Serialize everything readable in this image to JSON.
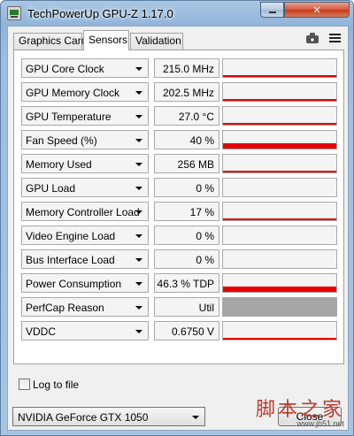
{
  "window": {
    "title": "TechPowerUp GPU-Z 1.17.0"
  },
  "tabs": [
    {
      "label": "Graphics Card"
    },
    {
      "label": "Sensors"
    },
    {
      "label": "Validation"
    }
  ],
  "icons": {
    "camera": "camera-icon",
    "menu": "menu-icon"
  },
  "accent_color": "#e60000",
  "sensors": [
    {
      "name": "GPU Core Clock",
      "value": "215.0 MHz",
      "graph_level": 0.04
    },
    {
      "name": "GPU Memory Clock",
      "value": "202.5 MHz",
      "graph_level": 0.04
    },
    {
      "name": "GPU Temperature",
      "value": "27.0 °C",
      "graph_level": 0.1
    },
    {
      "name": "Fan Speed (%)",
      "value": "40 %",
      "graph_level": 0.3
    },
    {
      "name": "Memory Used",
      "value": "256 MB",
      "graph_level": 0.04
    },
    {
      "name": "GPU Load",
      "value": "0 %",
      "graph_level": 0
    },
    {
      "name": "Memory Controller Load",
      "value": "17 %",
      "graph_level": 0.08
    },
    {
      "name": "Video Engine Load",
      "value": "0 %",
      "graph_level": 0
    },
    {
      "name": "Bus Interface Load",
      "value": "0 %",
      "graph_level": 0
    },
    {
      "name": "Power Consumption",
      "value": "46.3 % TDP",
      "graph_level": 0.32
    },
    {
      "name": "PerfCap Reason",
      "value": "Util",
      "graph_level": 1,
      "graph_color": "#a6a6a6"
    },
    {
      "name": "VDDC",
      "value": "0.6750 V",
      "graph_level": 0.1
    }
  ],
  "footer": {
    "log_to_file": {
      "label": "Log to file",
      "checked": false
    },
    "gpu_select": {
      "value": "NVIDIA GeForce GTX 1050"
    },
    "close_button": {
      "label": "Close"
    }
  },
  "watermark": {
    "logo": "脚本之家",
    "url": "www.jb51.net"
  }
}
